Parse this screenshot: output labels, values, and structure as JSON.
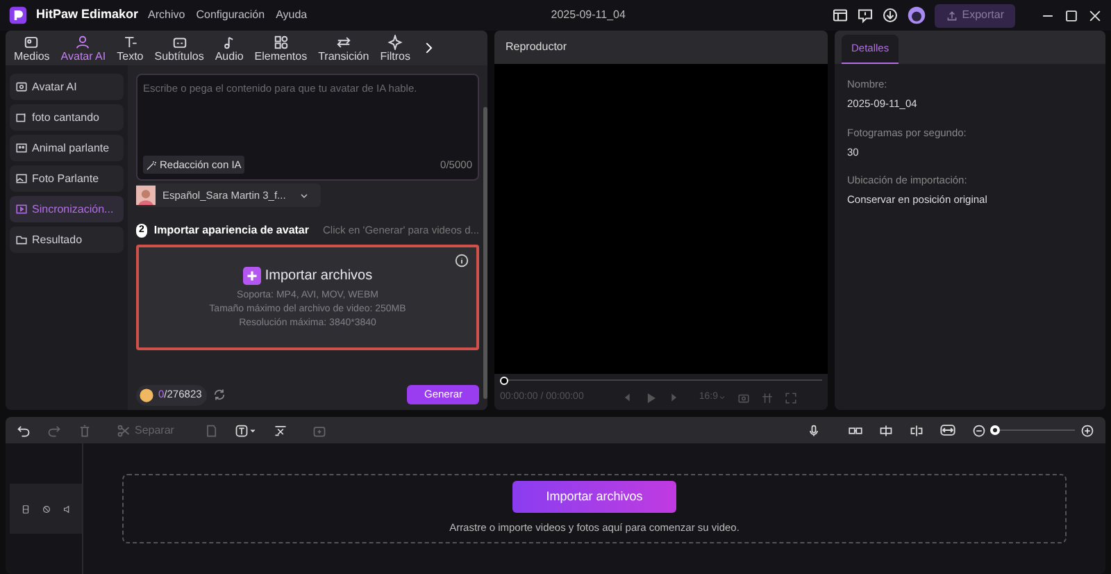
{
  "app": {
    "name": "HitPaw Edimakor",
    "menus": [
      "Archivo",
      "Configuración",
      "Ayuda"
    ],
    "project_title": "2025-09-11_04",
    "export_label": "Exportar"
  },
  "tabs": [
    {
      "label": "Medios",
      "selected": false,
      "kind": "media"
    },
    {
      "label": "Avatar AI",
      "selected": true,
      "kind": "avatar"
    },
    {
      "label": "Texto",
      "selected": false,
      "kind": "text"
    },
    {
      "label": "Subtítulos",
      "selected": false,
      "kind": "subtitles"
    },
    {
      "label": "Audio",
      "selected": false,
      "kind": "audio"
    },
    {
      "label": "Elementos",
      "selected": false,
      "kind": "elements"
    },
    {
      "label": "Transición",
      "selected": false,
      "kind": "transition"
    },
    {
      "label": "Filtros",
      "selected": false,
      "kind": "filters"
    }
  ],
  "sidebar": {
    "items": [
      {
        "label": "Avatar AI",
        "selected": false
      },
      {
        "label": "foto cantando",
        "selected": false
      },
      {
        "label": "Animal parlante",
        "selected": false
      },
      {
        "label": "Foto Parlante",
        "selected": false
      },
      {
        "label": "Sincronización...",
        "selected": true
      },
      {
        "label": "Resultado",
        "selected": false
      }
    ]
  },
  "script": {
    "placeholder": "Escribe o pega el contenido para que tu avatar de IA hable.",
    "ai_button": "Redacción con IA",
    "counter": "0/5000",
    "voice": "Español_Sara Martin 3_f..."
  },
  "step2": {
    "number": "2",
    "title": "Importar apariencia de avatar",
    "hint": "Click en 'Generar' para videos d..."
  },
  "import_box": {
    "label": "Importar archivos",
    "lines": [
      "Soporta: MP4, AVI, MOV, WEBM",
      "Tamaño máximo del archivo de video: 250MB",
      "Resolución máxima: 3840*3840"
    ]
  },
  "footer": {
    "credits_used": "0",
    "credits_total": "/276823",
    "generate": "Generar"
  },
  "player": {
    "title": "Reproductor",
    "progress": {
      "level": 0
    },
    "time": "00:00:00 / 00:00:00",
    "ratio": "16:9"
  },
  "details": {
    "tab": {
      "label": "Detalles",
      "selected": true
    },
    "fields": [
      {
        "label": "Nombre:",
        "value": "2025-09-11_04"
      },
      {
        "label": "Fotogramas por segundo:",
        "value": "30"
      },
      {
        "label": "Ubicación de importación:",
        "value": "Conservar en posición original"
      }
    ]
  },
  "timeline": {
    "split_label": "Separar",
    "zoom": {
      "level": 0.04
    },
    "import_button": "Importar archivos",
    "hint": "Arrastre o importe videos y fotos aquí para comenzar su video."
  }
}
